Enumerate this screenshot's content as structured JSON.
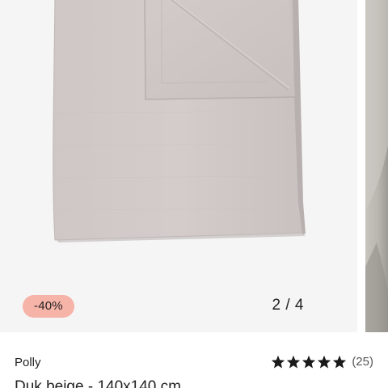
{
  "carousel": {
    "discount_badge": "-40%",
    "slide_counter": "2 / 4",
    "current_image_icon": "folded-tablecloth-image"
  },
  "product": {
    "brand": "Polly",
    "rating_stars": 5,
    "rating_max": 5,
    "review_count": "(25)",
    "title": "Duk beige - 140x140 cm"
  },
  "colors": {
    "badge_background": "#f6b3a8",
    "image_background": "#f5f5f5",
    "fabric": "#d1c9c7",
    "text": "#222222"
  }
}
